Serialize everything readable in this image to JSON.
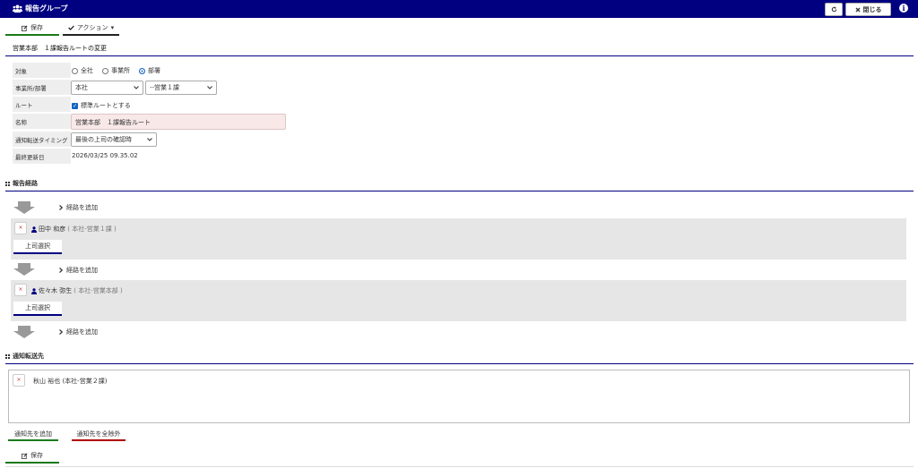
{
  "titlebar": {
    "icon": "users-icon",
    "title": "報告グループ",
    "refresh_icon": "refresh-icon",
    "close_label": "閉じる",
    "info_icon": "info-icon",
    "info_glyph": "i"
  },
  "toolbar": {
    "save_label": "保存",
    "action_label": "アクション",
    "action_caret": "▾"
  },
  "subtitle": "営業本部　１課報告ルートの変更",
  "form": {
    "target": {
      "label": "対象",
      "options": [
        "全社",
        "事業所",
        "部署"
      ],
      "selected": "部署"
    },
    "office": {
      "label": "事業所/部署",
      "office_value": "本社",
      "dept_value": "--営業１課"
    },
    "route": {
      "label": "ルート",
      "checkbox_label": "標準ルートとする",
      "checked": true
    },
    "name": {
      "label": "名称",
      "value": "営業本部　１課報告ルート"
    },
    "timing": {
      "label": "通知転送タイミング",
      "value": "最後の上司の確認時"
    },
    "updated": {
      "label": "最終更新日",
      "value": "2026/03/25 09.35.02"
    }
  },
  "report_route": {
    "title": "報告経路",
    "add_label": "経路を追加",
    "steps": [
      {
        "name": "田中 和彦",
        "detail": "( 本社-営業１課 )",
        "boss_label": "上司選択",
        "remove_glyph": "×"
      },
      {
        "name": "佐々木 弥生",
        "detail": "( 本社-営業本部 )",
        "boss_label": "上司選択",
        "remove_glyph": "×"
      }
    ]
  },
  "notify": {
    "title": "通知転送先",
    "entries": [
      {
        "name": "秋山 裕也 (本社-営業２課)",
        "remove_glyph": "×"
      }
    ],
    "add_label": "通知先を追加",
    "remove_all_label": "通知先を全除外"
  },
  "footer": {
    "save_label": "保存"
  },
  "colors": {
    "header": "#000080",
    "save_underline": "#1a7a1a",
    "remove_all_underline": "#b00000",
    "name_field_bg": "#f8e8e8",
    "radio_selected": "#1565c0"
  }
}
